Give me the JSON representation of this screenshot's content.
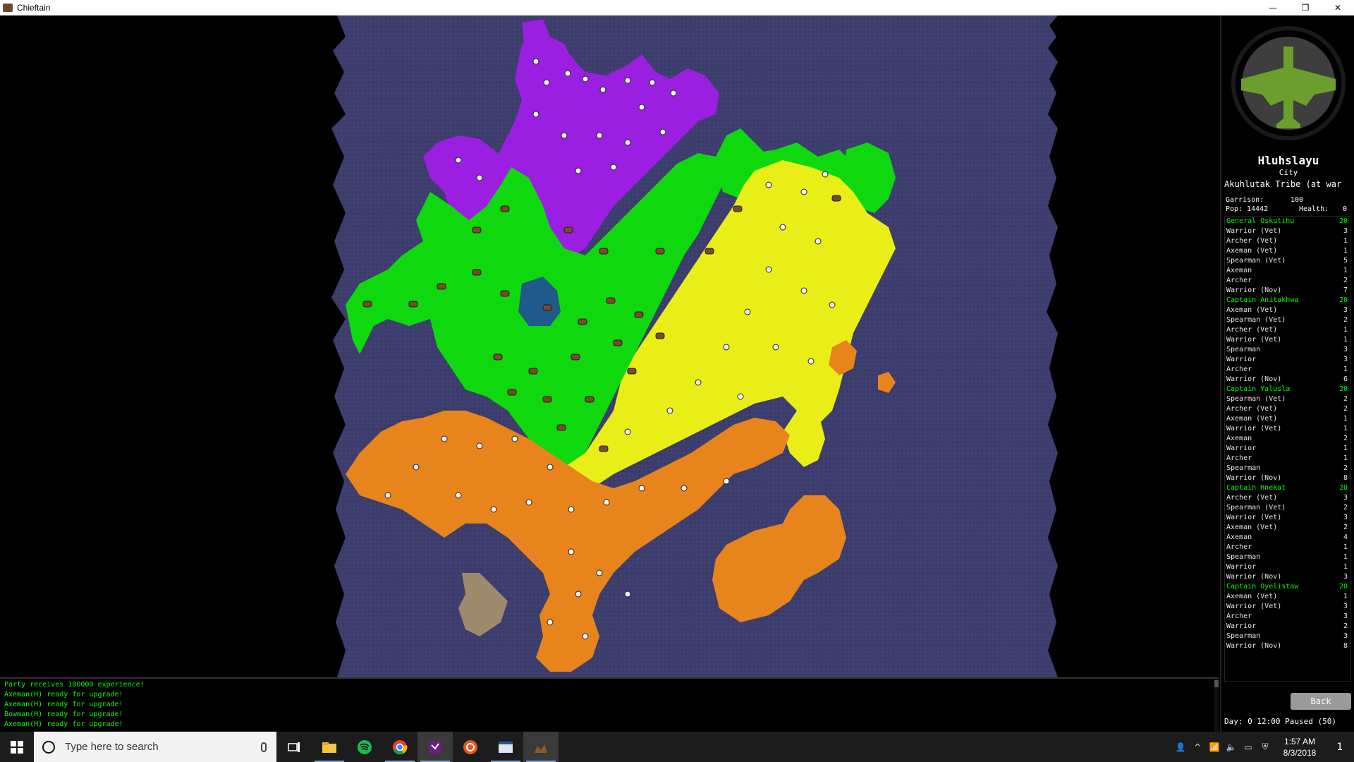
{
  "window": {
    "title": "Chieftain",
    "minimize_glyph": "—",
    "restore_glyph": "❐",
    "close_glyph": "✕"
  },
  "panel": {
    "city_name": "Hluhslayu",
    "city_type": "City",
    "tribe": "Akuhlutak Tribe (at war",
    "garrison_label": "Garrison:",
    "garrison_value": "100",
    "pop_label": "Pop:",
    "pop_value": "14442",
    "health_label": "Health:",
    "health_value": "0",
    "back_label": "Back",
    "day_info": "Day: 0 12:00   Paused (50)",
    "units": [
      {
        "name": "General Oskutihu",
        "count": "20",
        "leader": true
      },
      {
        "name": "Warrior (Vet)",
        "count": "3"
      },
      {
        "name": "Archer (Vet)",
        "count": "1"
      },
      {
        "name": "Axeman (Vet)",
        "count": "1"
      },
      {
        "name": "Spearman (Vet)",
        "count": "5"
      },
      {
        "name": "Axeman",
        "count": "1"
      },
      {
        "name": "Archer",
        "count": "2"
      },
      {
        "name": "Warrior (Nov)",
        "count": "7"
      },
      {
        "name": "Captain Anitakhwa",
        "count": "20",
        "leader": true
      },
      {
        "name": "Axeman (Vet)",
        "count": "3"
      },
      {
        "name": "Spearman (Vet)",
        "count": "2"
      },
      {
        "name": "Archer (Vet)",
        "count": "1"
      },
      {
        "name": "Warrior (Vet)",
        "count": "1"
      },
      {
        "name": "Spearman",
        "count": "3"
      },
      {
        "name": "Warrior",
        "count": "3"
      },
      {
        "name": "Archer",
        "count": "1"
      },
      {
        "name": "Warrior (Nov)",
        "count": "6"
      },
      {
        "name": "Captain Yalusla",
        "count": "20",
        "leader": true
      },
      {
        "name": "Spearman (Vet)",
        "count": "2"
      },
      {
        "name": "Archer (Vet)",
        "count": "2"
      },
      {
        "name": "Axeman (Vet)",
        "count": "1"
      },
      {
        "name": "Warrior (Vet)",
        "count": "1"
      },
      {
        "name": "Axeman",
        "count": "2"
      },
      {
        "name": "Warrior",
        "count": "1"
      },
      {
        "name": "Archer",
        "count": "1"
      },
      {
        "name": "Spearman",
        "count": "2"
      },
      {
        "name": "Warrior (Nov)",
        "count": "8"
      },
      {
        "name": "Captain Hnekat",
        "count": "20",
        "leader": true
      },
      {
        "name": "Archer (Vet)",
        "count": "3"
      },
      {
        "name": "Spearman (Vet)",
        "count": "2"
      },
      {
        "name": "Warrior (Vet)",
        "count": "3"
      },
      {
        "name": "Axeman (Vet)",
        "count": "2"
      },
      {
        "name": "Axeman",
        "count": "4"
      },
      {
        "name": "Archer",
        "count": "1"
      },
      {
        "name": "Spearman",
        "count": "1"
      },
      {
        "name": "Warrior",
        "count": "1"
      },
      {
        "name": "Warrior (Nov)",
        "count": "3"
      },
      {
        "name": "Captain Oyelistaw",
        "count": "20",
        "leader": true
      },
      {
        "name": "Axeman (Vet)",
        "count": "1"
      },
      {
        "name": "Warrior (Vet)",
        "count": "3"
      },
      {
        "name": "Archer",
        "count": "3"
      },
      {
        "name": "Warrior",
        "count": "2"
      },
      {
        "name": "Spearman",
        "count": "3"
      },
      {
        "name": "Warrior (Nov)",
        "count": "8"
      }
    ]
  },
  "log": {
    "lines": [
      "Party receives 100000 experience!",
      "Axeman(H) ready for upgrade!",
      "Axeman(H) ready for upgrade!",
      "Bowman(H) ready for upgrade!",
      "Axeman(H) ready for upgrade!"
    ]
  },
  "taskbar": {
    "search_placeholder": "Type here to search",
    "time": "1:57 AM",
    "date": "8/3/2018",
    "notification_count": "1",
    "apps": [
      "task-view-icon",
      "file-explorer-icon",
      "spotify-icon",
      "chrome-icon",
      "visual-studio-icon",
      "ubuntu-icon",
      "app-window-icon",
      "chieftain-icon"
    ]
  },
  "colors": {
    "ocean": "#3d3d6e",
    "purple_tribe": "#9b1fe0",
    "green_tribe": "#0fd80f",
    "yellow_tribe": "#e9ee18",
    "orange_tribe": "#e8841c",
    "neutral": "#9d8a6c",
    "lake": "#1f5a8a",
    "emblem_green": "#6b9e2c"
  }
}
